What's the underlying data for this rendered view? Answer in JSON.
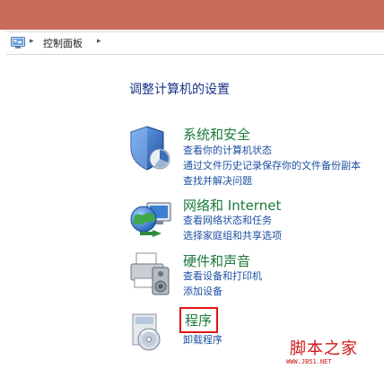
{
  "address": {
    "separator": "▸",
    "path": "控制面板"
  },
  "heading": "调整计算机的设置",
  "categories": [
    {
      "title": "系统和安全",
      "links": [
        "查看你的计算机状态",
        "通过文件历史记录保存你的文件备份副本",
        "查找并解决问题"
      ]
    },
    {
      "title": "网络和 Internet",
      "links": [
        "查看网络状态和任务",
        "选择家庭组和共享选项"
      ]
    },
    {
      "title": "硬件和声音",
      "links": [
        "查看设备和打印机",
        "添加设备"
      ]
    },
    {
      "title": "程序",
      "links": [
        "卸载程序"
      ]
    }
  ],
  "watermark": {
    "text": "脚本之家",
    "url": "WWW.JB51.NET"
  },
  "colors": {
    "titlebar": "#c96b5b",
    "category_title": "#1b7a3a",
    "link": "#1e50a2",
    "highlight_box": "#e01313"
  }
}
